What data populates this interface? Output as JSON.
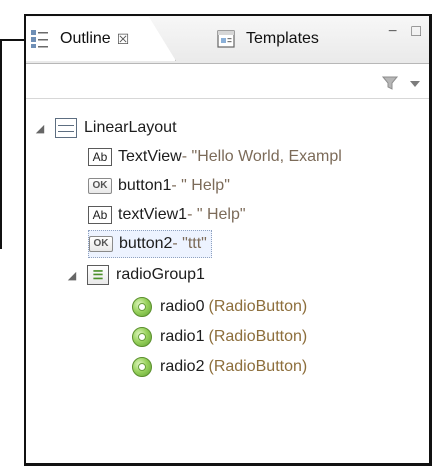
{
  "tabs": {
    "active": {
      "label": "Outline",
      "close": "☒",
      "icon": "outline-icon"
    },
    "inactive": {
      "label": "Templates",
      "icon": "templates-icon"
    }
  },
  "window_controls": {
    "minimize": "−",
    "maximize": "□"
  },
  "toolbar": {
    "filter_icon": "filter-icon",
    "menu_icon": "view-menu-icon"
  },
  "tree": {
    "root": {
      "name": "LinearLayout",
      "icon": "linear-layout-icon"
    },
    "children": [
      {
        "name": "TextView",
        "detail": " - \"Hello World, Exampl",
        "icon_text": "Ab",
        "icon": "textview-icon"
      },
      {
        "name": "button1",
        "detail": " - \" Help\"",
        "icon_text": "OK",
        "icon": "button-icon"
      },
      {
        "name": "textView1",
        "detail": " - \" Help\"",
        "icon_text": "Ab",
        "icon": "textview-icon"
      },
      {
        "name": "button2",
        "detail": " - \"ttt\"",
        "icon_text": "OK",
        "icon": "button-icon"
      },
      {
        "name": "radioGroup1",
        "icon": "radio-group-icon"
      }
    ],
    "radios": [
      {
        "name": "radio0",
        "detail": " (RadioButton)",
        "icon": "radio-button-icon"
      },
      {
        "name": "radio1",
        "detail": " (RadioButton)",
        "icon": "radio-button-icon"
      },
      {
        "name": "radio2",
        "detail": " (RadioButton)",
        "icon": "radio-button-icon"
      }
    ]
  },
  "colors": {
    "frame": "#111111",
    "detail": "#8d6e3b",
    "selection_bg": "#edf3ff",
    "radio_green": "#61a332"
  }
}
